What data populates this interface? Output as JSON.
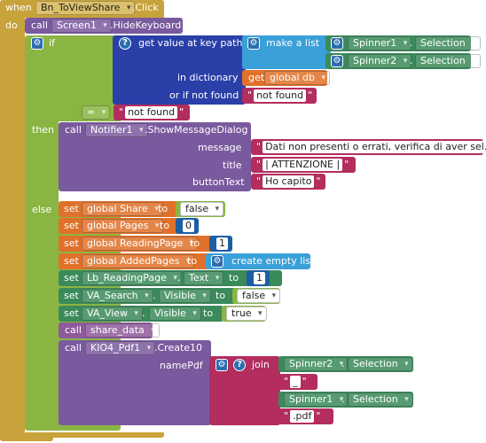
{
  "event": {
    "when": "when",
    "component": "Bn_ToViewShare",
    "event": ".Click",
    "do": "do"
  },
  "hide_kb": {
    "call": "call",
    "component": "Screen1",
    "method": ".HideKeyboard"
  },
  "if_block": {
    "if": "if",
    "get_value": "get value at key path",
    "make_list": "make a list",
    "spinner1": "Spinner1",
    "spinner2": "Spinner2",
    "selection": "Selection",
    "in_dictionary": "in dictionary",
    "get": "get",
    "global_db": "global db",
    "or_if_not_found": "or if not found",
    "not_found": "not found",
    "eq": "=",
    "not_found2": "not found"
  },
  "then_block": {
    "then": "then",
    "call": "call",
    "notifier": "Notifier1",
    "method": ".ShowMessageDialog",
    "message": "message",
    "message_value": "Dati non presenti o errati, verifica di aver sel...",
    "title": "title",
    "title_value": "| ATTENZIONE |",
    "button_text": "buttonText",
    "button_value": "Ho capito"
  },
  "else_block": {
    "else": "else",
    "set": "set",
    "to": "to",
    "global_share": "global Share",
    "false": "false",
    "global_pages": "global Pages",
    "zero": "0",
    "global_reading": "global ReadingPage",
    "one": "1",
    "global_added": "global AddedPages",
    "create_empty": "create empty list",
    "lb_reading": "Lb_ReadingPage",
    "text": "Text",
    "va_search": "VA_Search",
    "visible": "Visible",
    "va_view": "VA_View",
    "true": "true",
    "call": "call",
    "share_data": "share_data",
    "kio4": "KIO4_Pdf1",
    "create10": ".Create10",
    "name_pdf": "namePdf",
    "join": "join",
    "spinner2": "Spinner2",
    "spinner1": "Spinner1",
    "selection": "Selection",
    "underscore": "_",
    "pdf": ".pdf"
  },
  "colors": {
    "event": "#c8a23a",
    "component": "#7a5a9e",
    "control": "#8ab543",
    "dictionary": "#2b3fa8",
    "list": "#3aa0d8",
    "text": "#b32d5e",
    "variable": "#e0712a",
    "setter": "#3b8a5a",
    "math": "#1d5ea3",
    "procedure": "#8e5a9b"
  }
}
